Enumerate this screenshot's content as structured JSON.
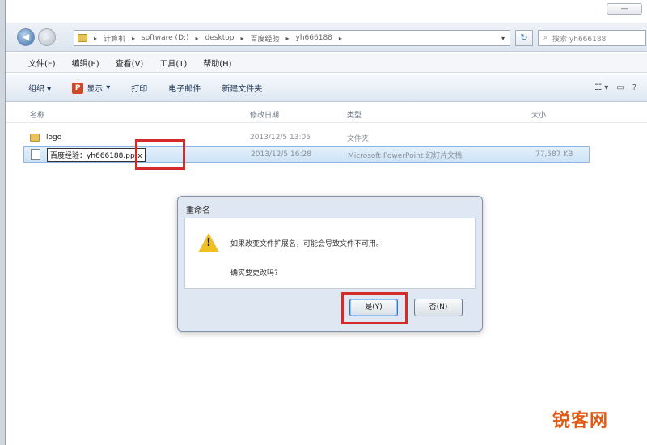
{
  "window": {
    "minimize_label": "—"
  },
  "address_bar": {
    "segments": [
      "计算机",
      "software (D:)",
      "desktop",
      "百度经验",
      "yh666188"
    ],
    "search_placeholder": "搜索 yh666188"
  },
  "menu": [
    "文件(F)",
    "编辑(E)",
    "查看(V)",
    "工具(T)",
    "帮助(H)"
  ],
  "toolbar": {
    "items": [
      "组织 ▾",
      "显示",
      "打印",
      "电子邮件",
      "新建文件夹"
    ]
  },
  "columns": {
    "name": "名称",
    "date": "修改日期",
    "type": "类型",
    "size": "大小"
  },
  "files": [
    {
      "name": "logo",
      "date": "2013/12/5 13:05",
      "type": "文件夹",
      "size": ""
    },
    {
      "name": "百度经验：yh666188.pptx",
      "date": "2013/12/5 16:28",
      "type": "Microsoft PowerPoint 幻灯片文档",
      "size": "77,587 KB"
    }
  ],
  "dialog": {
    "title": "重命名",
    "message": "如果改变文件扩展名，可能会导致文件不可用。",
    "question": "确实要更改吗?",
    "yes_label": "是(Y)",
    "no_label": "否(N)"
  },
  "watermark": "锐客网",
  "colors": {
    "highlight": "#d42a2a",
    "accent": "#3a76c7",
    "watermark": "#e05a14"
  }
}
